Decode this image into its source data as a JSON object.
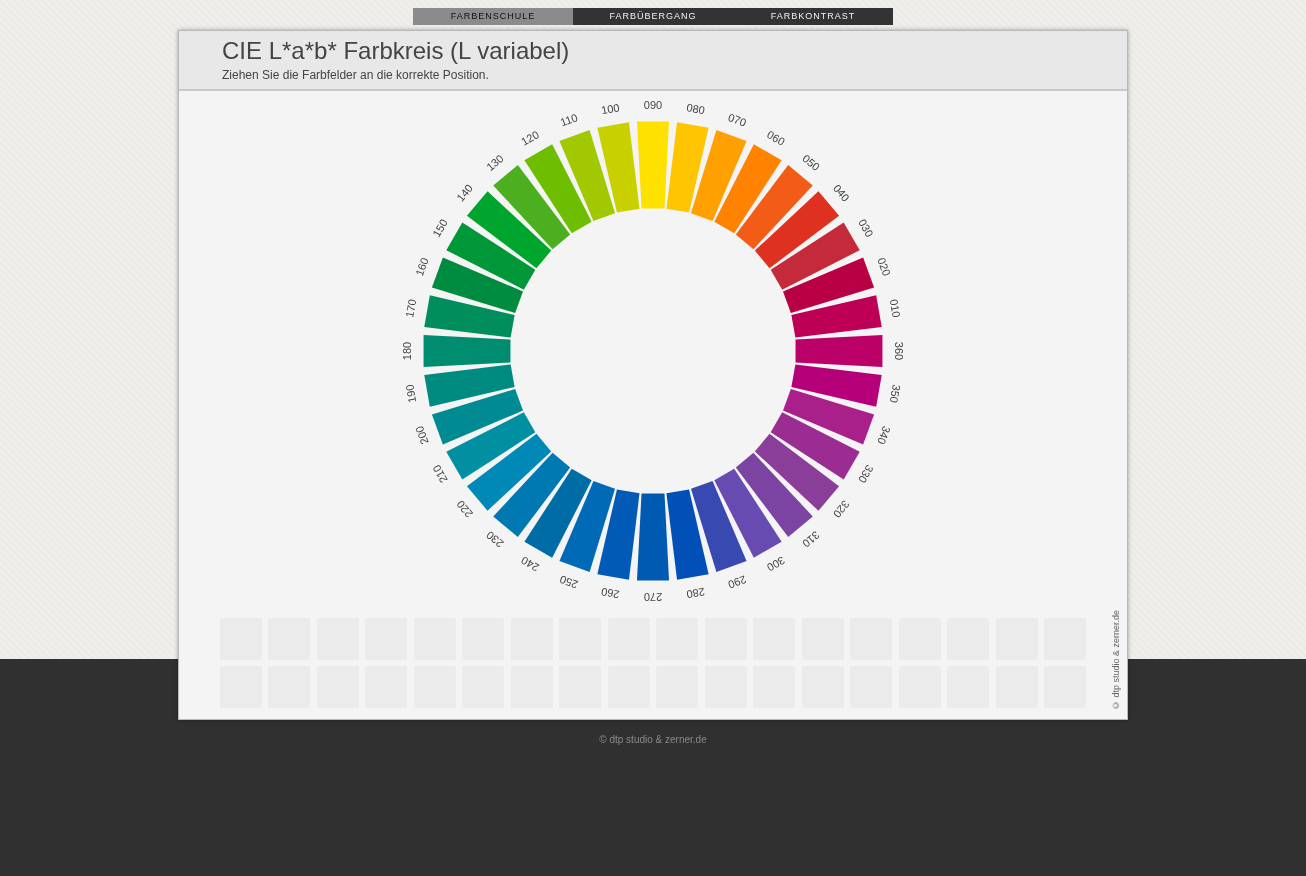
{
  "nav": {
    "tabs": [
      {
        "label": "FARBENSCHULE",
        "selected": true
      },
      {
        "label": "FARBÜBERGANG",
        "selected": false
      },
      {
        "label": "FARBKONTRAST",
        "selected": false
      }
    ]
  },
  "panel": {
    "title": "CIE L*a*b* Farbkreis (L variabel)",
    "subtitle": "Ziehen Sie die Farbfelder an die korrekte Position.",
    "wheel": {
      "segments": [
        {
          "label": "360",
          "color": "#bb0068"
        },
        {
          "label": "010",
          "color": "#bd0056"
        },
        {
          "label": "020",
          "color": "#b90044"
        },
        {
          "label": "030",
          "color": "#c52a3a"
        },
        {
          "label": "040",
          "color": "#df3120"
        },
        {
          "label": "050",
          "color": "#f25c16"
        },
        {
          "label": "060",
          "color": "#ff8200"
        },
        {
          "label": "070",
          "color": "#ffa000"
        },
        {
          "label": "080",
          "color": "#ffc500"
        },
        {
          "label": "090",
          "color": "#ffe100"
        },
        {
          "label": "100",
          "color": "#c9d000"
        },
        {
          "label": "110",
          "color": "#a1c800"
        },
        {
          "label": "120",
          "color": "#6ebe00"
        },
        {
          "label": "130",
          "color": "#4caf1f"
        },
        {
          "label": "140",
          "color": "#00a52d"
        },
        {
          "label": "150",
          "color": "#009738"
        },
        {
          "label": "160",
          "color": "#008c40"
        },
        {
          "label": "170",
          "color": "#008f5c"
        },
        {
          "label": "180",
          "color": "#008c6e"
        },
        {
          "label": "190",
          "color": "#008b80"
        },
        {
          "label": "200",
          "color": "#008a91"
        },
        {
          "label": "210",
          "color": "#0090a2"
        },
        {
          "label": "220",
          "color": "#0089b6"
        },
        {
          "label": "230",
          "color": "#0079b2"
        },
        {
          "label": "240",
          "color": "#006ca6"
        },
        {
          "label": "250",
          "color": "#006ab6"
        },
        {
          "label": "260",
          "color": "#005ab6"
        },
        {
          "label": "270",
          "color": "#005ab2"
        },
        {
          "label": "280",
          "color": "#0050b8"
        },
        {
          "label": "290",
          "color": "#3849b2"
        },
        {
          "label": "300",
          "color": "#684bb1"
        },
        {
          "label": "310",
          "color": "#7b44a2"
        },
        {
          "label": "320",
          "color": "#8a3e99"
        },
        {
          "label": "330",
          "color": "#9b2d92"
        },
        {
          "label": "340",
          "color": "#a9208a"
        },
        {
          "label": "350",
          "color": "#b6007a"
        }
      ]
    },
    "side_credit": "© dtp studio & zerner.de"
  },
  "footer": {
    "credit": "© dtp studio & zerner.de"
  }
}
